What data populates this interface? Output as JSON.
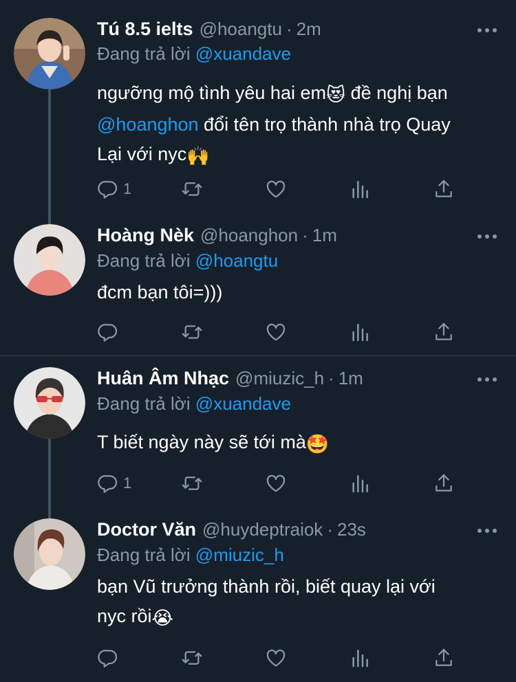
{
  "tweets": [
    {
      "name": "Tú 8.5 ielts",
      "handle": "@hoangtu",
      "time": "2m",
      "replying_label": "Đang trả lời",
      "replying_to": "@xuandave",
      "text_1": "ngưỡng mộ tình yêu hai em",
      "emoji_1": "😻",
      "text_2": " đề nghị bạn",
      "mention": "@hoanghon",
      "text_3": " đổi tên trọ thành nhà trọ Quay",
      "text_4": "Lại với nyc",
      "emoji_2": "🙌",
      "reply_count": "1"
    },
    {
      "name": "Hoàng Nèk",
      "handle": "@hoanghon",
      "time": "1m",
      "replying_label": "Đang trả lời",
      "replying_to": "@hoangtu",
      "text": "đcm bạn tôi=)))",
      "reply_count": ""
    },
    {
      "name": "Huân Âm Nhạc",
      "handle": "@miuzic_h",
      "time": "1m",
      "replying_label": "Đang trả lời",
      "replying_to": "@xuandave",
      "text": "T biết ngày này sẽ tới mà",
      "emoji": "🤩",
      "reply_count": "1"
    },
    {
      "name": "Doctor Văn",
      "handle": "@huydeptraiok",
      "time": "23s",
      "replying_label": "Đang trả lời",
      "replying_to": "@miuzic_h",
      "text_1": "bạn Vũ trưởng thành rồi, biết quay lại với",
      "text_2": "nyc rồi",
      "emoji": "😭",
      "reply_count": ""
    }
  ],
  "separator": "·",
  "colors": {
    "background": "#15202b",
    "accent": "#1d9bf0",
    "muted": "#8899a6",
    "divider": "#38444d"
  },
  "icons": [
    "reply-icon",
    "retweet-icon",
    "like-icon",
    "analytics-icon",
    "share-icon",
    "more-icon"
  ]
}
